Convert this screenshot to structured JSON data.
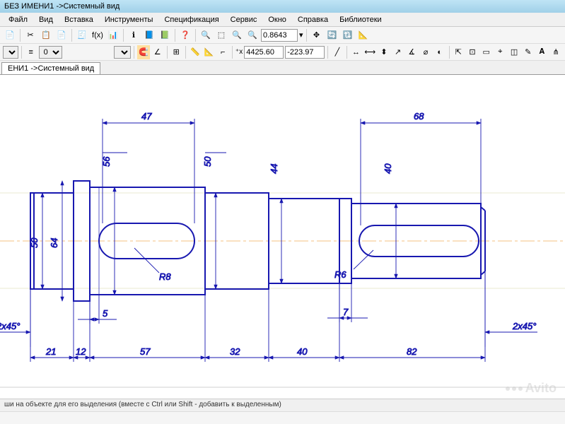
{
  "window": {
    "title": "БЕЗ ИМЕНИ1 ->Системный вид"
  },
  "menu": {
    "file": "Файл",
    "view": "Вид",
    "insert": "Вставка",
    "tools": "Инструменты",
    "spec": "Спецификация",
    "service": "Сервис",
    "window": "Окно",
    "help": "Справка",
    "libraries": "Библиотеки"
  },
  "toolbar2": {
    "zoom_value": "0.8643",
    "coord_x": "4425.60",
    "coord_y": "-223.97"
  },
  "toolbar3_combo": "0",
  "tab": {
    "active": "ЕНИ1 ->Системный вид"
  },
  "status": {
    "hint": "ши на объекте для его выделения (вместе с Ctrl или Shift - добавить к выделенным)"
  },
  "watermark": "Avito",
  "drawing": {
    "top_dim_1": "47",
    "top_dim_2": "68",
    "vert_1": "56",
    "vert_2": "50",
    "vert_3": "44",
    "vert_4": "40",
    "vert_5": "50",
    "vert_6": "64",
    "radius_1": "R8",
    "radius_2": "R6",
    "small_1": "5",
    "small_2": "7",
    "chamfer_1": "2x45°",
    "chamfer_2": "2x45°",
    "bottom_1": "21",
    "bottom_2": "12",
    "bottom_3": "57",
    "bottom_4": "32",
    "bottom_5": "40",
    "bottom_6": "82"
  },
  "chart_data": {
    "type": "table",
    "title": "CAD shaft drawing dimensions",
    "segments_length": [
      21,
      12,
      57,
      32,
      40,
      82
    ],
    "diameters": [
      50,
      64,
      56,
      50,
      44,
      40
    ],
    "keyways": [
      {
        "width_region": 47,
        "radius": "R8"
      },
      {
        "width_region": 68,
        "radius": "R6"
      }
    ],
    "chamfers": [
      "2x45°",
      "2x45°"
    ],
    "small_features": {
      "groove_width_1": 5,
      "groove_width_2": 7
    }
  }
}
